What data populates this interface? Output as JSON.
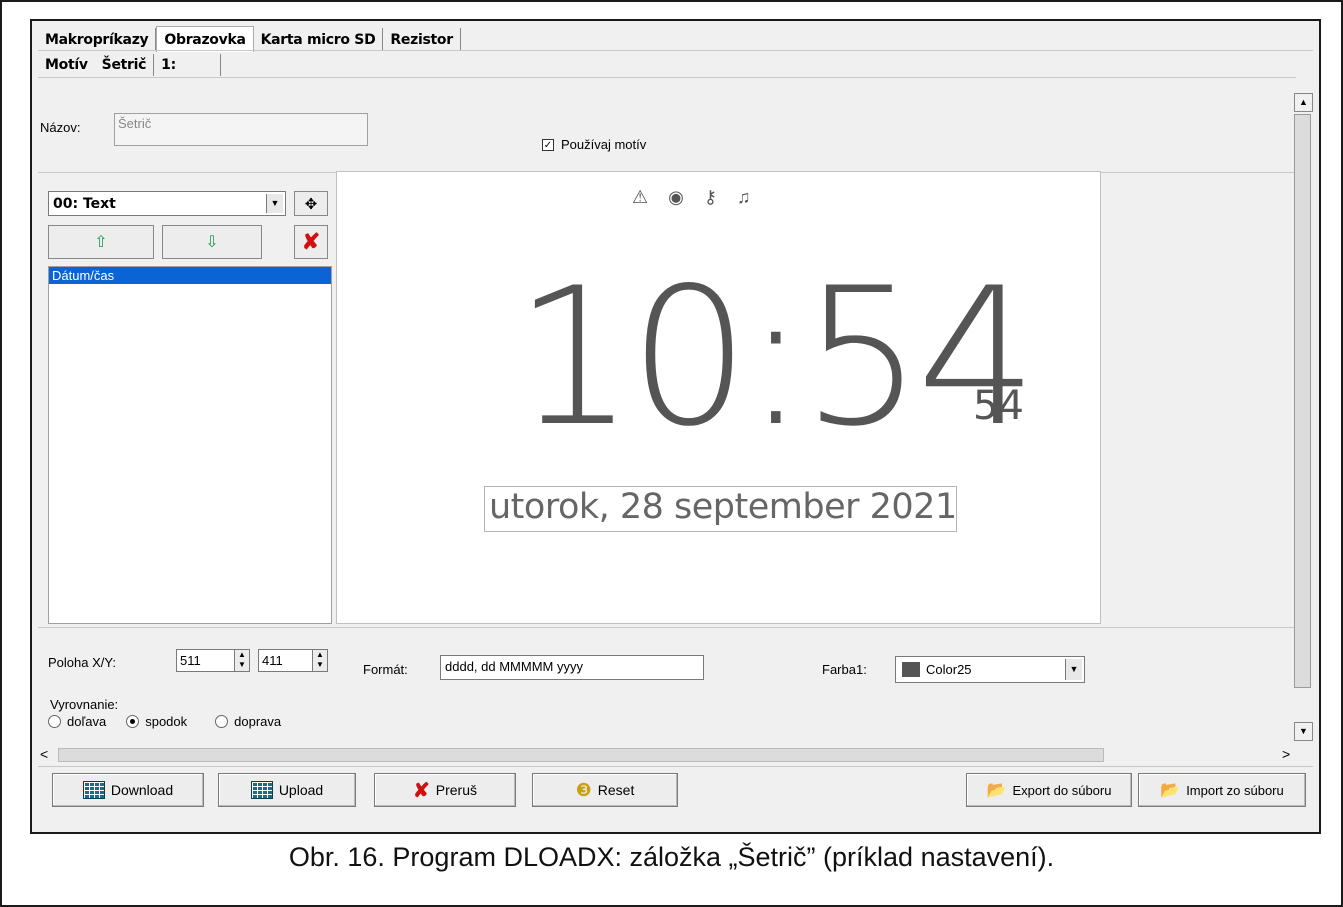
{
  "tabs": [
    "Makropríkazy",
    "Obrazovka",
    "Karta micro SD",
    "Rezistor"
  ],
  "subtabs": [
    "Motív",
    "Šetrič",
    "1:"
  ],
  "name_label": "Názov:",
  "name_value": "Šetrič",
  "use_theme_label": "Používaj motív",
  "use_theme_checked": true,
  "element_combo": "00: Text",
  "list_items": [
    "Dátum/čas"
  ],
  "preview": {
    "time": "10:54",
    "seconds": "54",
    "date": "utorok, 28 september 2021"
  },
  "position_label": "Poloha X/Y:",
  "pos_x": "511",
  "pos_y": "411",
  "format_label": "Formát:",
  "format_value": "dddd, dd MMMMM yyyy",
  "color_label": "Farba1:",
  "color_value": "Color25",
  "color_swatch": "#555555",
  "align_label": "Vyrovnanie:",
  "align_options": [
    "doľava",
    "spodok",
    "doprava"
  ],
  "align_selected": "spodok",
  "buttons": {
    "download": "Download",
    "upload": "Upload",
    "abort": "Preruš",
    "reset": "Reset",
    "export": "Export do súboru",
    "import": "Import zo súboru"
  },
  "caption": "Obr. 16. Program DLOADX: záložka „Šetrič” (príklad nastavení)."
}
